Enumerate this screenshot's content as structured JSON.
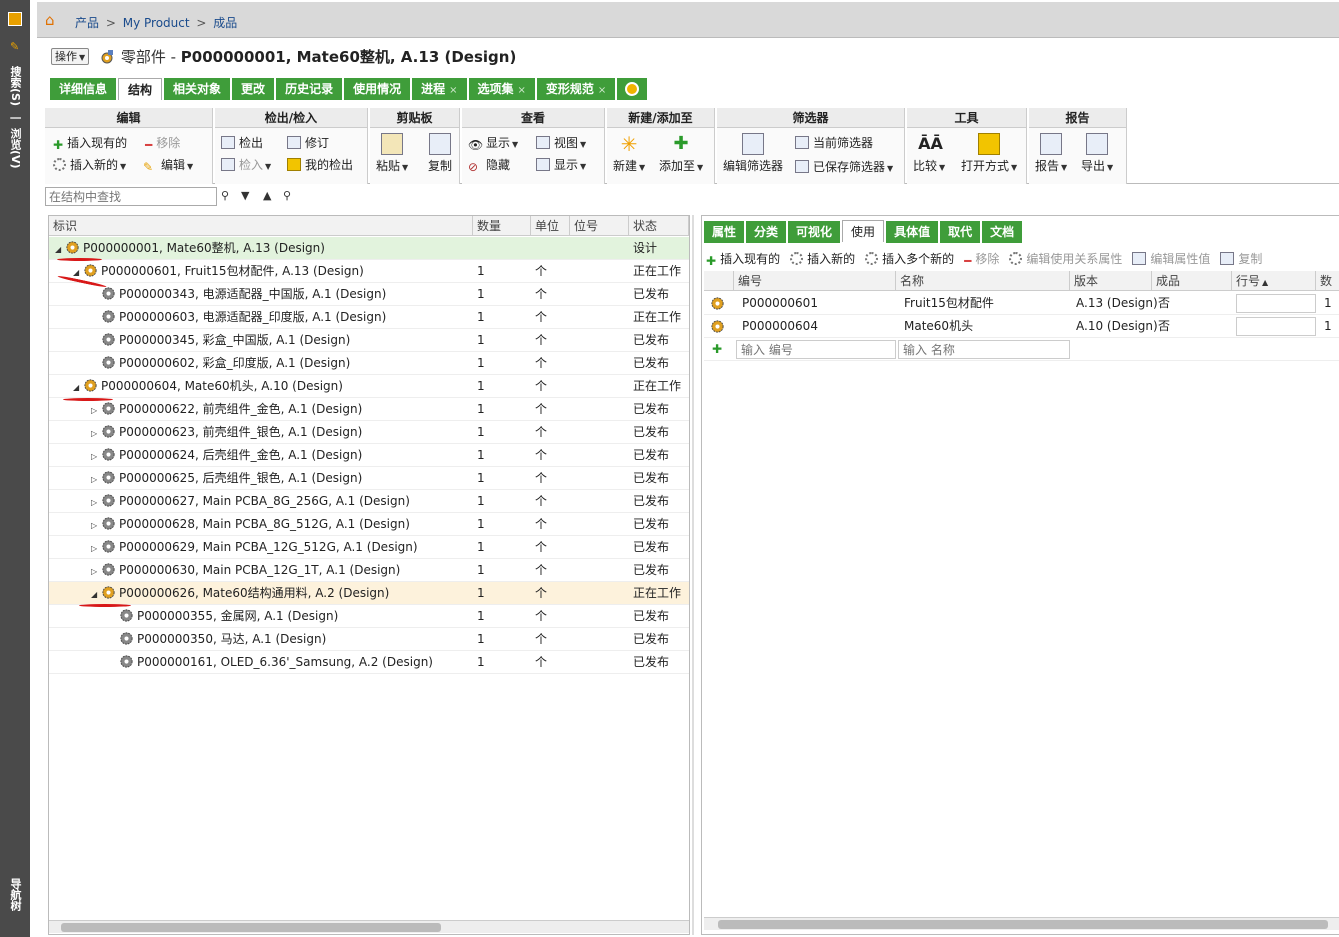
{
  "sidebar": {
    "label_search": "搜索(S)",
    "label_sep": "|",
    "label_browse": "浏览(V)",
    "label_bottom": "导航树"
  },
  "breadcrumb": {
    "items": [
      "产品",
      "My Product",
      "成品"
    ],
    "sep": ">"
  },
  "header": {
    "action_button": "操作",
    "type_label": "零部件 - ",
    "title": "P000000001, Mate60整机, A.13 (Design)"
  },
  "tabs": [
    {
      "label": "详细信息",
      "closable": false
    },
    {
      "label": "结构",
      "closable": false,
      "active": true
    },
    {
      "label": "相关对象",
      "closable": false
    },
    {
      "label": "更改",
      "closable": false
    },
    {
      "label": "历史记录",
      "closable": false
    },
    {
      "label": "使用情况",
      "closable": false
    },
    {
      "label": "进程",
      "closable": true
    },
    {
      "label": "选项集",
      "closable": true
    },
    {
      "label": "变形规范",
      "closable": true
    }
  ],
  "tab_close_symbol": "×",
  "ribbon": {
    "edit": {
      "title": "编辑",
      "insert_existing": "插入现有的",
      "remove": "移除",
      "insert_new": "插入新的",
      "edit": "编辑"
    },
    "checkout": {
      "title": "检出/检入",
      "checkout": "检出",
      "revise": "修订",
      "checkin": "检入",
      "my_checkouts": "我的检出"
    },
    "clipboard": {
      "title": "剪贴板",
      "paste": "粘贴",
      "copy": "复制"
    },
    "view": {
      "title": "查看",
      "show": "显示",
      "view": "视图",
      "hide": "隐藏",
      "display": "显示"
    },
    "new_add": {
      "title": "新建/添加至",
      "new": "新建",
      "add_to": "添加至"
    },
    "filter": {
      "title": "筛选器",
      "edit_filter": "编辑筛选器",
      "current_filter": "当前筛选器",
      "saved_filter": "已保存筛选器"
    },
    "tools": {
      "title": "工具",
      "compare": "比较",
      "open_with": "打开方式"
    },
    "report": {
      "title": "报告",
      "report": "报告",
      "export": "导出"
    }
  },
  "search": {
    "placeholder": "在结构中查找"
  },
  "tree": {
    "columns": [
      "标识",
      "数量",
      "单位",
      "位号",
      "状态"
    ],
    "rows": [
      {
        "label": "P000000001, Mate60整机, A.13 (Design)",
        "qty": "",
        "unit": "",
        "state": "设计"
      },
      {
        "label": "P000000601, Fruit15包材配件, A.13 (Design)",
        "qty": "1",
        "unit": "个",
        "state": "正在工作"
      },
      {
        "label": "P000000343, 电源适配器_中国版, A.1 (Design)",
        "qty": "1",
        "unit": "个",
        "state": "已发布"
      },
      {
        "label": "P000000603, 电源适配器_印度版, A.1 (Design)",
        "qty": "1",
        "unit": "个",
        "state": "正在工作"
      },
      {
        "label": "P000000345, 彩盒_中国版, A.1 (Design)",
        "qty": "1",
        "unit": "个",
        "state": "已发布"
      },
      {
        "label": "P000000602, 彩盒_印度版, A.1 (Design)",
        "qty": "1",
        "unit": "个",
        "state": "已发布"
      },
      {
        "label": "P000000604, Mate60机头, A.10 (Design)",
        "qty": "1",
        "unit": "个",
        "state": "正在工作"
      },
      {
        "label": "P000000622, 前壳组件_金色, A.1 (Design)",
        "qty": "1",
        "unit": "个",
        "state": "已发布"
      },
      {
        "label": "P000000623, 前壳组件_银色, A.1 (Design)",
        "qty": "1",
        "unit": "个",
        "state": "已发布"
      },
      {
        "label": "P000000624, 后壳组件_金色, A.1 (Design)",
        "qty": "1",
        "unit": "个",
        "state": "已发布"
      },
      {
        "label": "P000000625, 后壳组件_银色, A.1 (Design)",
        "qty": "1",
        "unit": "个",
        "state": "已发布"
      },
      {
        "label": "P000000627, Main PCBA_8G_256G, A.1 (Design)",
        "qty": "1",
        "unit": "个",
        "state": "已发布"
      },
      {
        "label": "P000000628, Main PCBA_8G_512G, A.1 (Design)",
        "qty": "1",
        "unit": "个",
        "state": "已发布"
      },
      {
        "label": "P000000629, Main PCBA_12G_512G, A.1 (Design)",
        "qty": "1",
        "unit": "个",
        "state": "已发布"
      },
      {
        "label": "P000000630, Main PCBA_12G_1T, A.1 (Design)",
        "qty": "1",
        "unit": "个",
        "state": "已发布"
      },
      {
        "label": "P000000626, Mate60结构通用料, A.2 (Design)",
        "qty": "1",
        "unit": "个",
        "state": "正在工作"
      },
      {
        "label": "P000000355, 金属网, A.1 (Design)",
        "qty": "1",
        "unit": "个",
        "state": "已发布"
      },
      {
        "label": "P000000350, 马达, A.1 (Design)",
        "qty": "1",
        "unit": "个",
        "state": "已发布"
      },
      {
        "label": "P000000161, OLED_6.36'_Samsung, A.2 (Design)",
        "qty": "1",
        "unit": "个",
        "state": "已发布"
      }
    ]
  },
  "right": {
    "tabs": [
      "属性",
      "分类",
      "可视化",
      "使用",
      "具体值",
      "取代",
      "文档"
    ],
    "toolbar": {
      "insert_existing": "插入现有的",
      "insert_new": "插入新的",
      "insert_multi": "插入多个新的",
      "remove": "移除",
      "edit_usage_attrs": "编辑使用关系属性",
      "edit_attr_values": "编辑属性值",
      "copy": "复制"
    },
    "columns": [
      "编号",
      "名称",
      "版本",
      "成品",
      "行号",
      "数量"
    ],
    "rows": [
      {
        "number": "P000000601",
        "name": "Fruit15包材配件",
        "version": "A.13 (Design)",
        "finished": "否",
        "qty": "1"
      },
      {
        "number": "P000000604",
        "name": "Mate60机头",
        "version": "A.10 (Design)",
        "finished": "否",
        "qty": "1"
      }
    ],
    "input_number_placeholder": "输入 编号",
    "input_name_placeholder": "输入 名称"
  }
}
